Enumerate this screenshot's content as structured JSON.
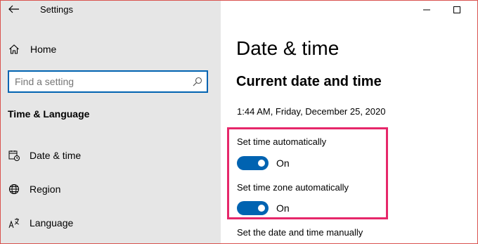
{
  "window": {
    "title": "Settings",
    "back_icon": "arrow-left-icon",
    "minimize_icon": "minimize-icon",
    "maximize_icon": "maximize-icon"
  },
  "sidebar": {
    "home_label": "Home",
    "home_icon": "home-icon",
    "search": {
      "placeholder": "Find a setting",
      "value": "",
      "icon": "search-icon"
    },
    "section_heading": "Time & Language",
    "items": [
      {
        "label": "Date & time",
        "icon": "calendar-clock-icon"
      },
      {
        "label": "Region",
        "icon": "globe-icon"
      },
      {
        "label": "Language",
        "icon": "language-icon"
      }
    ]
  },
  "main": {
    "page_title": "Date & time",
    "section_title": "Current date and time",
    "current_datetime": "1:44 AM, Friday, December 25, 2020",
    "settings": [
      {
        "label": "Set time automatically",
        "state": "On",
        "enabled": true
      },
      {
        "label": "Set time zone automatically",
        "state": "On",
        "enabled": true
      }
    ],
    "manual_label": "Set the date and time manually"
  },
  "colors": {
    "accent": "#0063b1",
    "highlight_border": "#e6276a",
    "sidebar_bg": "#e6e6e6",
    "window_border": "#d9534f"
  }
}
